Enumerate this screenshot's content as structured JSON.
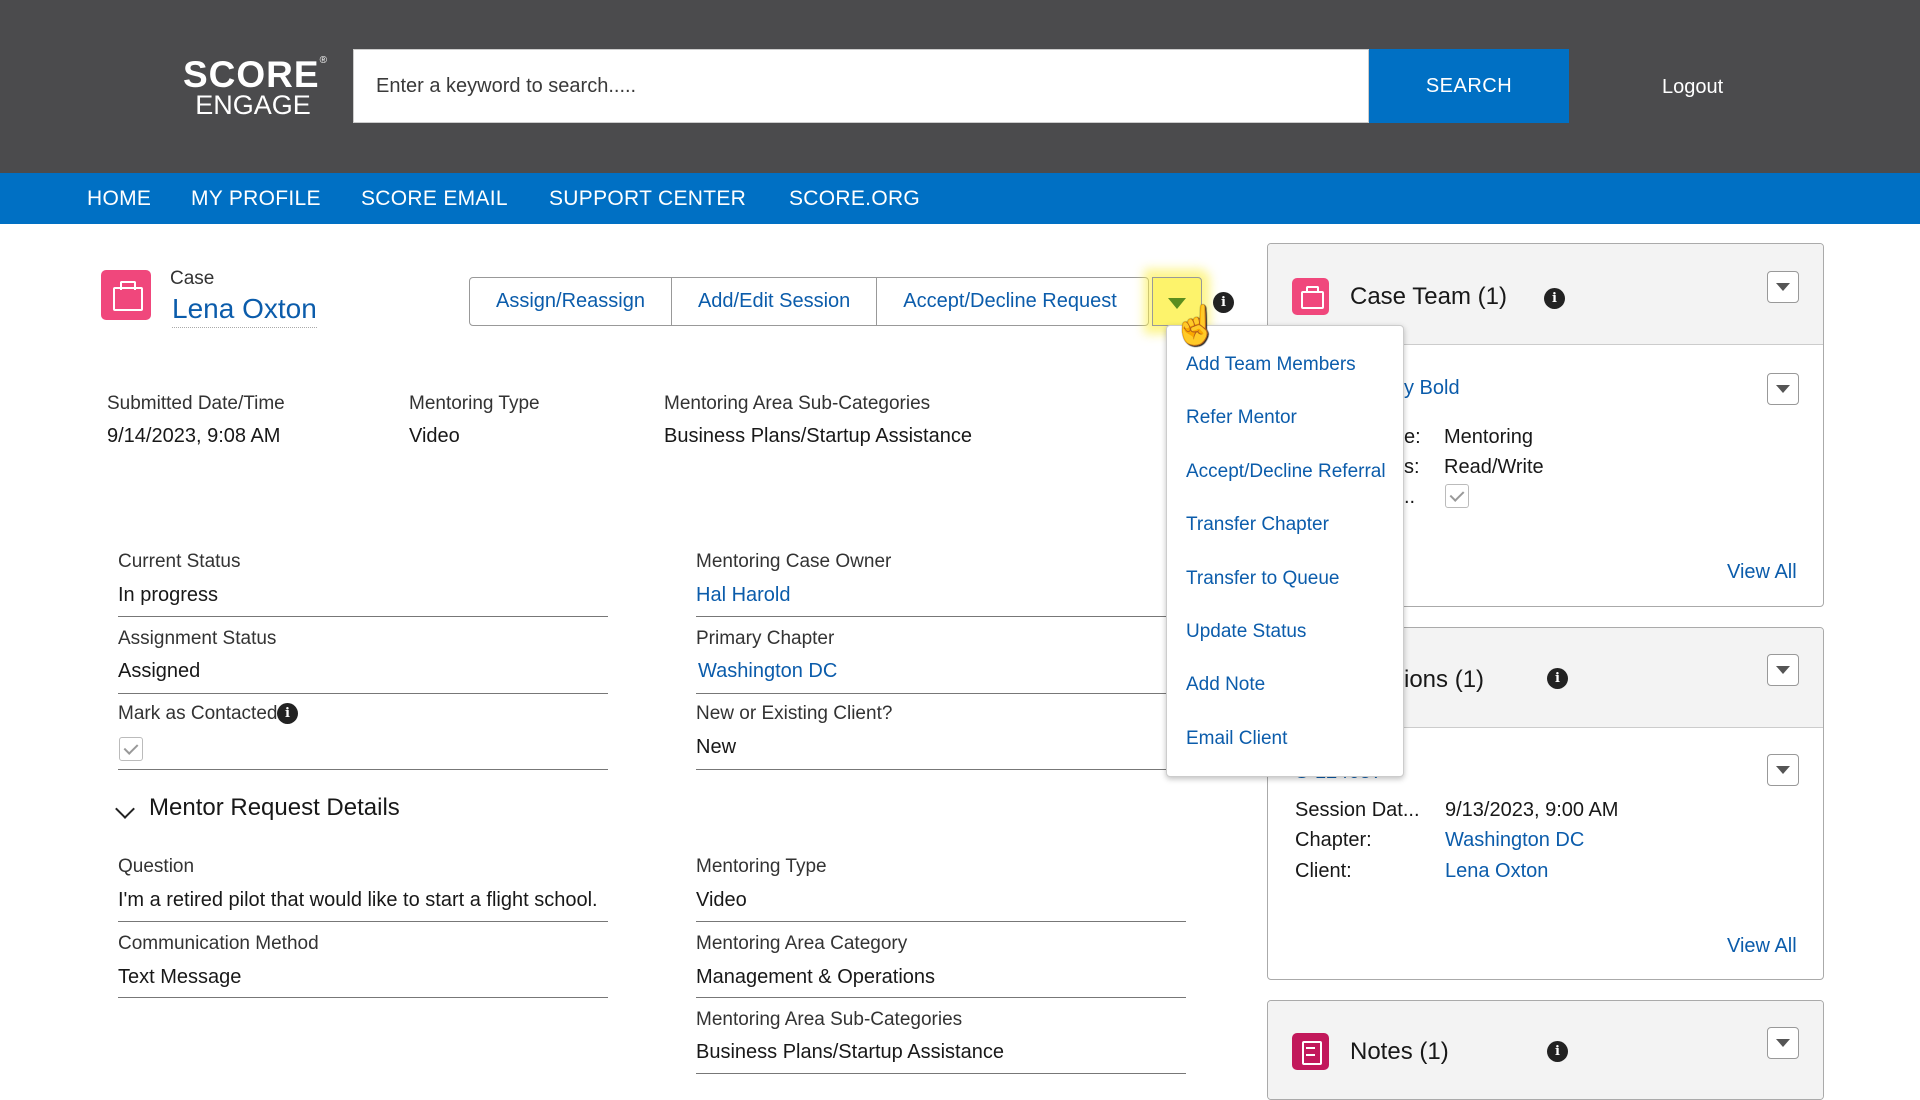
{
  "header": {
    "logo_line1": "SCORE",
    "logo_line2": "ENGAGE",
    "search_placeholder": "Enter a keyword to search.....",
    "search_button": "SEARCH",
    "logout": "Logout"
  },
  "nav": [
    "HOME",
    "MY PROFILE",
    "SCORE EMAIL",
    "SUPPORT CENTER",
    "SCORE.ORG"
  ],
  "record": {
    "type_label": "Case",
    "name": "Lena Oxton",
    "actions": [
      "Assign/Reassign",
      "Add/Edit Session",
      "Accept/Decline Request"
    ]
  },
  "highlights": [
    {
      "label": "Submitted Date/Time",
      "value": "9/14/2023, 9:08 AM"
    },
    {
      "label": "Mentoring Type",
      "value": "Video"
    },
    {
      "label": "Mentoring Area Sub-Categories",
      "value": "Business Plans/Startup Assistance"
    }
  ],
  "details": {
    "current_status_label": "Current Status",
    "current_status": "In progress",
    "owner_label": "Mentoring Case Owner",
    "owner": "Hal Harold",
    "assignment_status_label": "Assignment Status",
    "assignment_status": "Assigned",
    "primary_chapter_label": "Primary Chapter",
    "primary_chapter": "Washington DC",
    "mark_contacted_label": "Mark as Contacted",
    "client_type_label": "New or Existing Client?",
    "client_type": "New"
  },
  "mentor_request": {
    "section_title": "Mentor Request Details",
    "question_label": "Question",
    "question": "I'm a retired pilot that would like to start a flight school.",
    "mentoring_type_label": "Mentoring Type",
    "mentoring_type": "Video",
    "communication_label": "Communication Method",
    "communication": "Text Message",
    "area_category_label": "Mentoring Area Category",
    "area_category": "Management & Operations",
    "sub_categories_label": "Mentoring Area Sub-Categories",
    "sub_categories": "Business Plans/Startup Assistance"
  },
  "dropdown_menu": [
    "Add Team Members",
    "Refer Mentor",
    "Accept/Decline Referral",
    "Transfer Chapter",
    "Transfer to Queue",
    "Update Status",
    "Add Note",
    "Email Client"
  ],
  "case_team": {
    "title": "Case Team (1)",
    "member_name": "y Bold",
    "row1_label": "e:",
    "row1_value": "Mentoring",
    "row2_label": "s:",
    "row2_value": "Read/Write",
    "row3_label": "..",
    "view_all": "View All"
  },
  "sessions": {
    "title": "ions (1)",
    "record_id": "S-12463?",
    "session_date_label": "Session Dat...",
    "session_date": "9/13/2023, 9:00 AM",
    "chapter_label": "Chapter:",
    "chapter": "Washington DC",
    "client_label": "Client:",
    "client": "Lena Oxton",
    "view_all": "View All"
  },
  "notes": {
    "title": "Notes (1)"
  },
  "colors": {
    "topbar": "#4b4b4d",
    "nav": "#0070c4",
    "link": "#0b5cab",
    "case_icon": "#f0477c",
    "notes_icon": "#c2185b",
    "highlight": "#fdf36b"
  }
}
